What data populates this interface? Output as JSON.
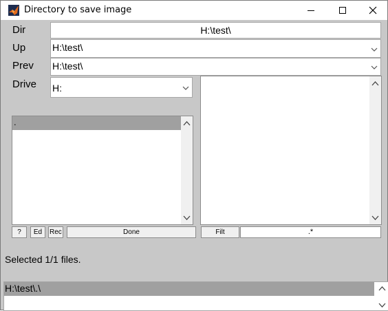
{
  "window": {
    "title": "Directory to save image",
    "controls": {
      "minimize": "minimize",
      "maximize": "maximize",
      "close": "close"
    }
  },
  "dir": {
    "label": "Dir",
    "value": "H:\\test\\"
  },
  "up": {
    "label": "Up",
    "value": "H:\\test\\"
  },
  "prev": {
    "label": "Prev",
    "value": "H:\\test\\"
  },
  "drive": {
    "label": "Drive",
    "value": "H:"
  },
  "dir_list": {
    "items": [
      "."
    ],
    "selected_index": 0
  },
  "buttons": {
    "help": "?",
    "edit": "Ed",
    "rec": "Rec",
    "done": "Done",
    "filt": "Filt"
  },
  "filter": {
    "value": ".*"
  },
  "status": {
    "text": "Selected 1/1 files."
  },
  "selected_files": {
    "items": [
      "H:\\test\\.\\"
    ]
  },
  "colors": {
    "background": "#c8c8c8",
    "selection": "#a0a0a0",
    "field": "#ffffff"
  },
  "icons": {
    "app": "matlab-logo-icon",
    "dropdown": "chevron-down-icon",
    "scroll_up": "scroll-up-icon",
    "scroll_down": "scroll-down-icon"
  }
}
